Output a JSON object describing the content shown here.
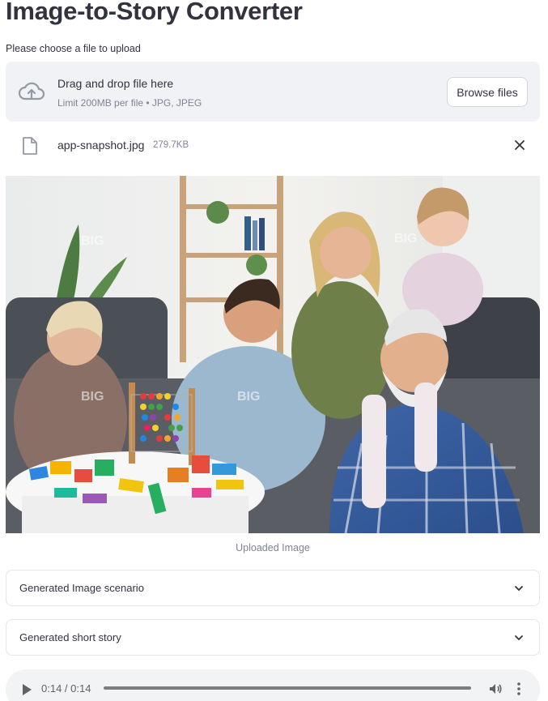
{
  "page": {
    "title": "Image-to-Story Converter"
  },
  "uploader": {
    "label": "Please choose a file to upload",
    "dropzone_title": "Drag and drop file here",
    "dropzone_limit": "Limit 200MB per file • JPG, JPEG",
    "browse_label": "Browse files",
    "cloud_icon": "cloud-upload-icon"
  },
  "file": {
    "name": "app-snapshot.jpg",
    "size": "279.7KB",
    "icon": "file-icon",
    "remove_icon": "close-icon"
  },
  "image": {
    "caption": "Uploaded Image",
    "watermark": "BIG"
  },
  "expanders": [
    {
      "label": "Generated Image scenario"
    },
    {
      "label": "Generated short story"
    }
  ],
  "audio": {
    "time": "0:14 / 0:14",
    "progress": 1.0
  },
  "colors": {
    "text": "#31333f",
    "muted": "#808495",
    "dropzone_bg": "#f0f2f6",
    "border": "#e6e6ea",
    "audio_bg": "#f1f3f4"
  }
}
